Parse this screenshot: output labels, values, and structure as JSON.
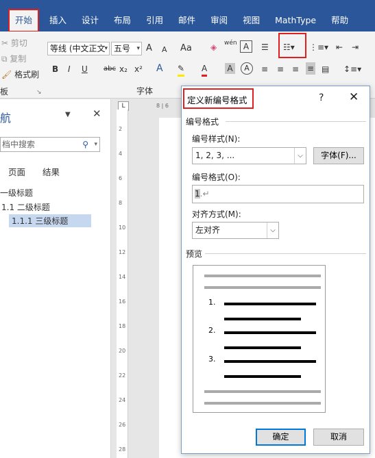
{
  "ribbon": {
    "tabs": [
      "开始",
      "插入",
      "设计",
      "布局",
      "引用",
      "邮件",
      "审阅",
      "视图",
      "MathType",
      "帮助"
    ],
    "clipboard": {
      "cut": "剪切",
      "copy": "复制",
      "format_painter": "格式刷",
      "group_label": "板"
    },
    "font": {
      "name": "等线 (中文正文",
      "size": "五号",
      "group_label": "字体",
      "case_label": "Aa",
      "wen_label": "wén"
    },
    "font_buttons": [
      "A",
      "A"
    ],
    "format_buttons": [
      "B",
      "I",
      "U",
      "abc",
      "x₂",
      "x²"
    ]
  },
  "nav": {
    "title": "航",
    "search_placeholder": "档中搜索",
    "tabs": [
      "页面",
      "结果"
    ],
    "headings": [
      {
        "label": "一级标题",
        "level": 1
      },
      {
        "label": "1.1 二级标题",
        "level": 2
      },
      {
        "label": "1.1.1 三级标题",
        "level": 3,
        "selected": true
      }
    ]
  },
  "ruler": {
    "h_marks": "8 | 6",
    "v_marks": [
      "2",
      "4",
      "6",
      "8",
      "10",
      "12",
      "14",
      "16",
      "18",
      "20",
      "22",
      "24",
      "26",
      "28"
    ]
  },
  "dialog": {
    "title": "定义新编号格式",
    "help": "?",
    "close": "✕",
    "section_number_format": "编号格式",
    "style_label": "编号样式(N):",
    "style_value": "1, 2, 3, ...",
    "font_button": "字体(F)...",
    "format_label": "编号格式(O):",
    "format_value_selected": "1",
    "format_value_rest": ".↵",
    "align_label": "对齐方式(M):",
    "align_value": "左对齐",
    "preview_label": "预览",
    "preview_numbers": [
      "1.",
      "2.",
      "3."
    ],
    "ok": "确定",
    "cancel": "取消"
  },
  "colors": {
    "accent": "#2b579a",
    "highlight": "#e02020",
    "selection": "#c5d8f0"
  }
}
